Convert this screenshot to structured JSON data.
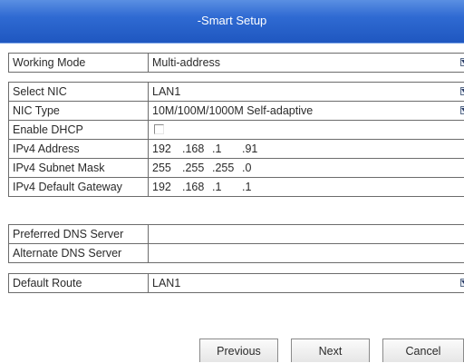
{
  "window": {
    "title": "-Smart Setup"
  },
  "groups": {
    "mode": {
      "working_mode": {
        "label": "Working Mode",
        "value": "Multi-address"
      }
    },
    "nic": {
      "select_nic": {
        "label": "Select NIC",
        "value": "LAN1"
      },
      "nic_type": {
        "label": "NIC Type",
        "value": "10M/100M/1000M Self-adaptive"
      },
      "enable_dhcp": {
        "label": "Enable DHCP",
        "checked": false
      },
      "ipv4_address": {
        "label": "IPv4 Address",
        "octets": [
          "192",
          ".168",
          ".1",
          ".91"
        ]
      },
      "subnet_mask": {
        "label": "IPv4 Subnet Mask",
        "octets": [
          "255",
          ".255",
          ".255",
          ".0"
        ]
      },
      "gateway": {
        "label": "IPv4 Default Gateway",
        "octets": [
          "192",
          ".168",
          ".1",
          ".1"
        ]
      }
    },
    "dns": {
      "preferred": {
        "label": "Preferred DNS Server",
        "value": ""
      },
      "alternate": {
        "label": "Alternate DNS Server",
        "value": ""
      }
    },
    "route": {
      "default_route": {
        "label": "Default Route",
        "value": "LAN1"
      }
    }
  },
  "buttons": {
    "previous": "Previous",
    "next": "Next",
    "cancel": "Cancel"
  },
  "icons": {
    "dropdown": "chevron-down-icon",
    "checkbox": "checkbox-icon"
  },
  "colors": {
    "titlebar": "#2f6ad2",
    "border": "#6c6c6c",
    "text": "#2a2a2a"
  }
}
